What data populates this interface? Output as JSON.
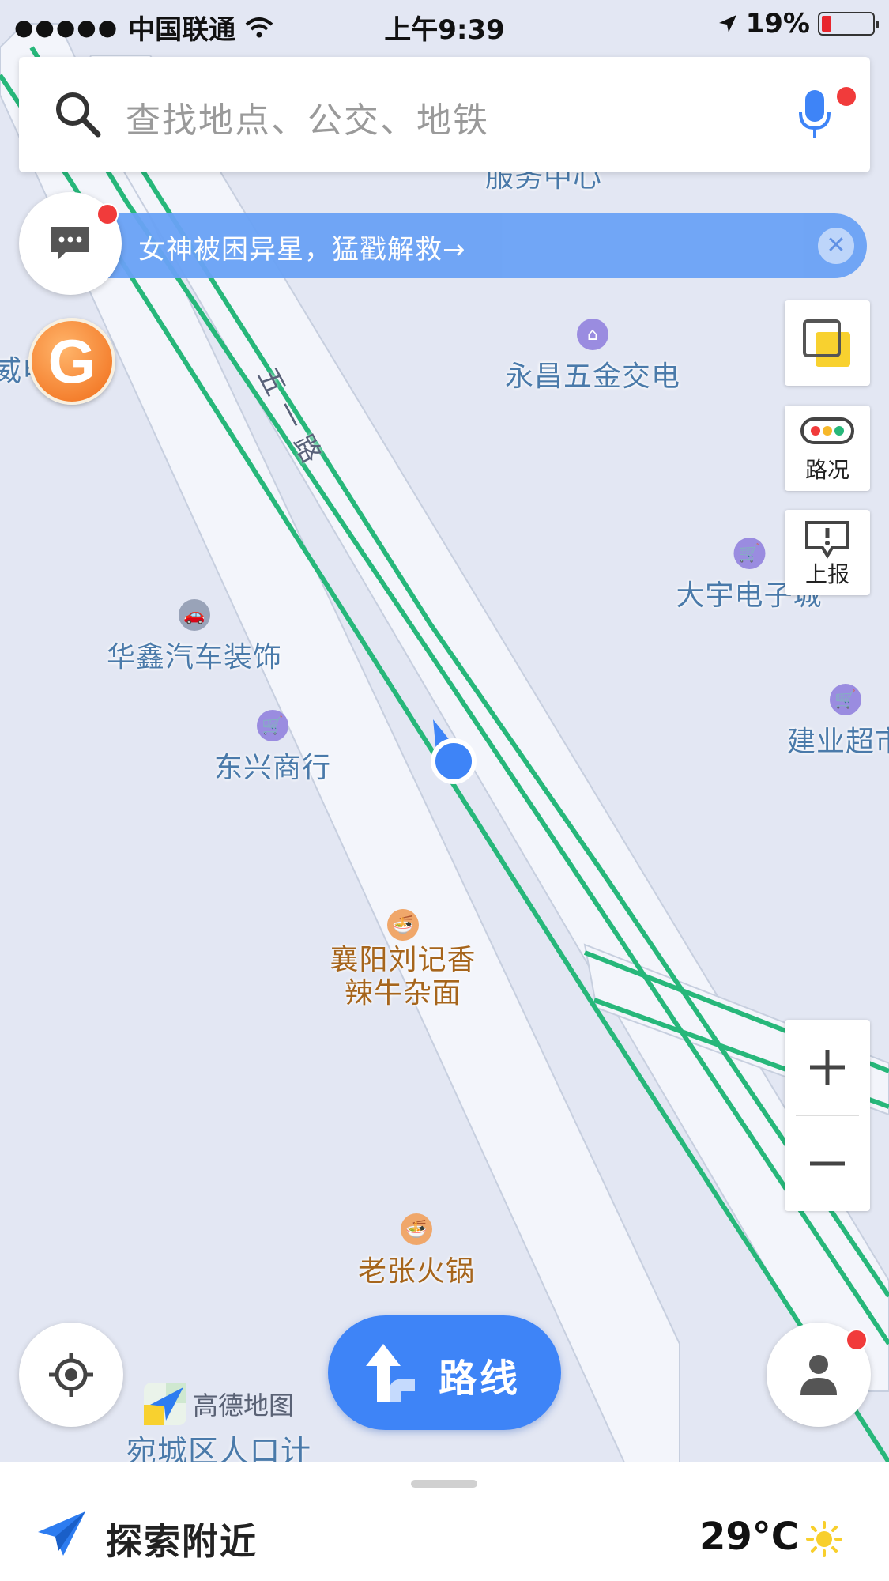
{
  "status_bar": {
    "signal": "●●●●●",
    "carrier": "中国联通",
    "time": "上午9:39",
    "battery": "19%",
    "battery_level": 0.19
  },
  "search": {
    "placeholder": "查找地点、公交、地铁"
  },
  "banner": {
    "text": "女神被困异星，猛戳解救→",
    "close": "✕"
  },
  "tools": {
    "traffic_label": "路况",
    "report_label": "上报"
  },
  "zoom": {
    "in": "+",
    "out": "−"
  },
  "map": {
    "road_name": "五一路",
    "pois": [
      {
        "label": "服务中心",
        "style": "blue"
      },
      {
        "label": "威电",
        "style": "blue"
      },
      {
        "label": "永昌五金交电",
        "style": "blue",
        "icon": "shop-icon"
      },
      {
        "label": "大宇电子城",
        "style": "blue",
        "icon": "cart-icon"
      },
      {
        "label": "华鑫汽车装饰",
        "style": "blue",
        "icon": "car-icon"
      },
      {
        "label": "东兴商行",
        "style": "blue",
        "icon": "cart-icon"
      },
      {
        "label": "建业超市",
        "style": "blue",
        "icon": "cart-icon"
      },
      {
        "label": "襄阳刘记香\n辣牛杂面",
        "style": "brown",
        "icon": "noodle-icon"
      },
      {
        "label": "老张火锅",
        "style": "brown",
        "icon": "noodle-icon"
      }
    ],
    "district_label": "宛城区人口计"
  },
  "brand": {
    "name": "高德地图"
  },
  "route_button": {
    "label": "路线"
  },
  "bottom_panel": {
    "explore_label": "探索附近",
    "temperature": "29°C"
  },
  "colors": {
    "map_bg": "#e3e7f3",
    "road_green": "#27b77a",
    "accent_blue": "#3e84f7",
    "poi_blue": "#4a7aaa",
    "poi_brown": "#a6651c"
  }
}
